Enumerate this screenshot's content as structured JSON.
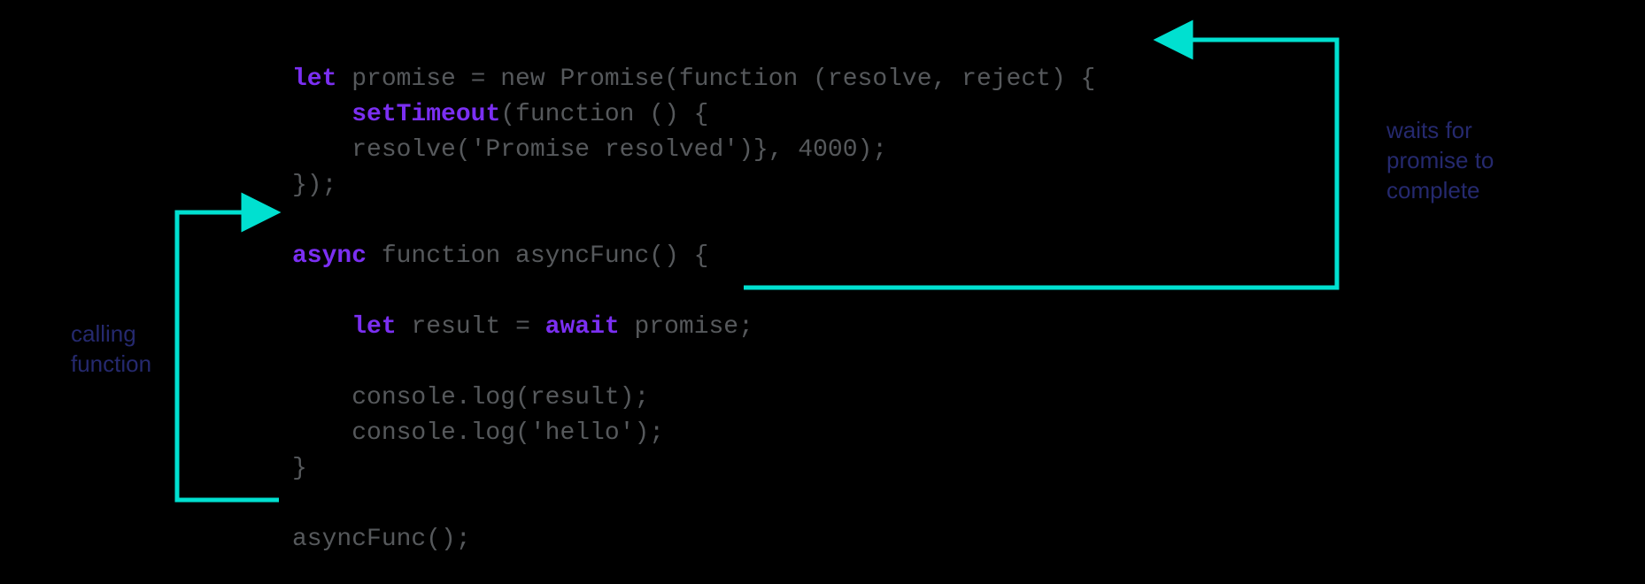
{
  "code": {
    "l1": {
      "kw_let": "let",
      "rest": " promise = new Promise(function (resolve, reject) {"
    },
    "l2": {
      "fn": "setTimeout",
      "rest": "(function () {"
    },
    "l3": "    resolve('Promise resolved')}, 4000);",
    "l4": "});",
    "l5": {
      "kw_async": "async",
      "rest": " function asyncFunc() {"
    },
    "l6": {
      "pad": "    ",
      "kw_let": "let",
      "mid": " result = ",
      "kw_await": "await",
      "rest": " promise;"
    },
    "l7": "    console.log(result);",
    "l8": "    console.log('hello');",
    "l9": "}",
    "l10": "asyncFunc();"
  },
  "labels": {
    "left_l1": "calling",
    "left_l2": "function",
    "right_l1": "waits for",
    "right_l2": "promise to",
    "right_l3": "complete"
  },
  "colors": {
    "arrow": "#00e0d0",
    "label": "#25296e",
    "keyword": "#7b2ff2",
    "code": "#56595c"
  }
}
